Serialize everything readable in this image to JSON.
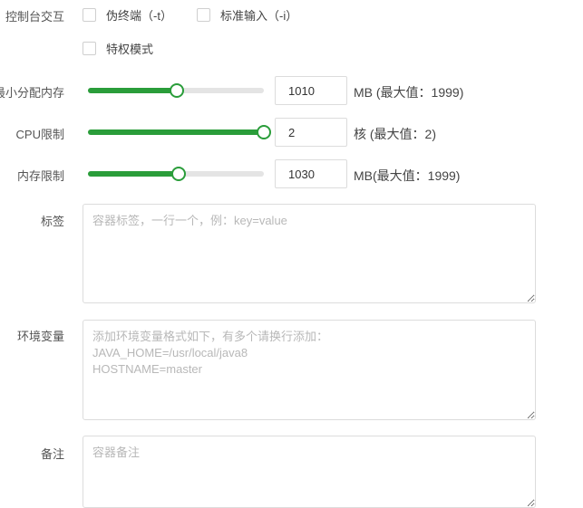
{
  "console": {
    "label": "控制台交互",
    "pseudo_terminal": "伪终端（-t）",
    "stdin": "标准输入（-i）",
    "privileged": "特权模式"
  },
  "memory_min": {
    "label": "最小分配内存",
    "value": "1010",
    "unit": "MB (最大值：1999)",
    "fraction": 0.505
  },
  "cpu": {
    "label": "CPU限制",
    "value": "2",
    "unit": "核 (最大值：2)",
    "fraction": 1.0
  },
  "memory_limit": {
    "label": "内存限制",
    "value": "1030",
    "unit": "MB(最大值：1999)",
    "fraction": 0.515
  },
  "labels": {
    "label": "标签",
    "placeholder": "容器标签，一行一个，例：key=value"
  },
  "env": {
    "label": "环境变量",
    "placeholder": "添加环境变量格式如下，有多个请换行添加：\nJAVA_HOME=/usr/local/java8\nHOSTNAME=master"
  },
  "remark": {
    "label": "备注",
    "placeholder": "容器备注"
  },
  "accent_color": "#2a9d3a"
}
